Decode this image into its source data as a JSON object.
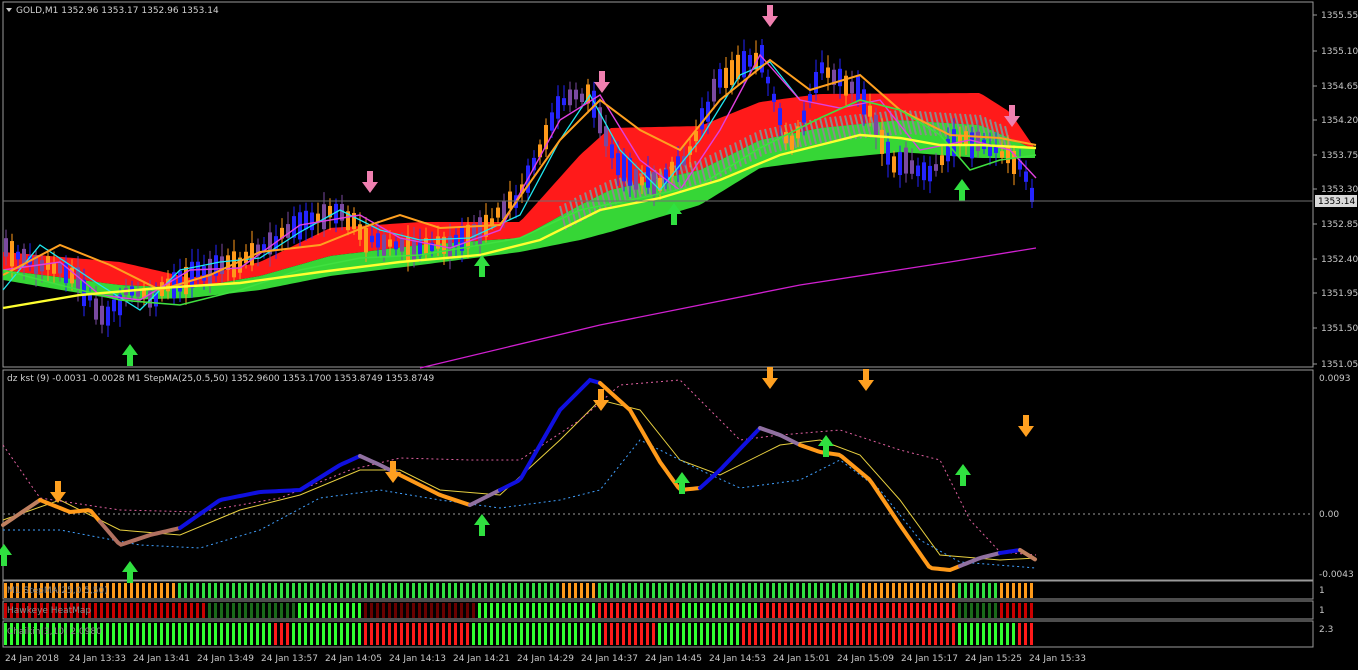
{
  "main": {
    "symbol_header": "GOLD,M1  1352.96 1353.17 1352.96 1353.14",
    "price_tag": "1353.14",
    "price_levels": [
      "1355.55",
      "1355.10",
      "1354.65",
      "1354.20",
      "1353.75",
      "1353.30",
      "1352.85",
      "1352.40",
      "1351.95",
      "1351.50",
      "1351.05"
    ]
  },
  "sub": {
    "header": "dz kst (9) -0.0031 -0.0028  M1 StepMA(25,0.5,50) 1352.9600 1353.1700 1353.8749 1353.8749",
    "levels": [
      "0.0093",
      "0.00",
      "-0.0043"
    ]
  },
  "strips": [
    {
      "label": "M1 StepMA(25,0.5,50)",
      "scale": "1"
    },
    {
      "label": "Hawkeye HeatMap",
      "scale": "1"
    },
    {
      "label": "Chaikin(3,10) 2.0980",
      "scale": "2.3"
    }
  ],
  "time_labels": [
    "24 Jan 2018",
    "24 Jan 13:33",
    "24 Jan 13:41",
    "24 Jan 13:49",
    "24 Jan 13:57",
    "24 Jan 14:05",
    "24 Jan 14:13",
    "24 Jan 14:21",
    "24 Jan 14:29",
    "24 Jan 14:37",
    "24 Jan 14:45",
    "24 Jan 14:53",
    "24 Jan 15:01",
    "24 Jan 15:09",
    "24 Jan 15:17",
    "24 Jan 15:25",
    "24 Jan 15:33"
  ],
  "colors": {
    "bull": "#1a1aff",
    "bear": "#ffa020",
    "kst": "#1010e0",
    "signal": "#ff9a1a",
    "bg": "#000000"
  }
}
